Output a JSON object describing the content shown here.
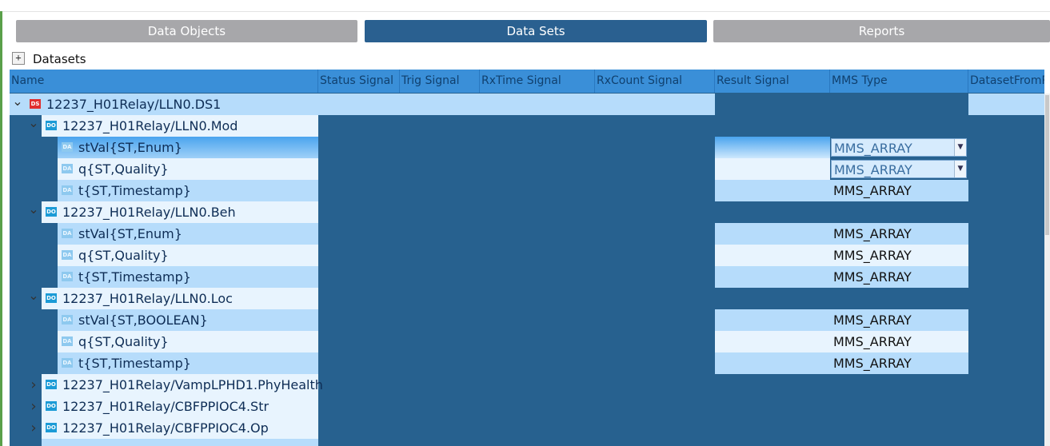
{
  "tabs": [
    {
      "label": "Data Objects",
      "active": false
    },
    {
      "label": "Data Sets",
      "active": true
    },
    {
      "label": "Reports",
      "active": false
    }
  ],
  "datasets_header": {
    "title": "Datasets",
    "expander": "+"
  },
  "columns": [
    "Name",
    "Status Signal",
    "Trig Signal",
    "RxTime Signal",
    "RxCount Signal",
    "Result Signal",
    "MMS Type",
    "DatasetFromR"
  ],
  "rows": [
    {
      "kind": "ds",
      "badge": "DS",
      "label": "12237_H01Relay/LLN0.DS1",
      "expanded": true,
      "mms": ""
    },
    {
      "kind": "do",
      "badge": "DO",
      "label": "12237_H01Relay/LLN0.Mod",
      "expanded": true,
      "mms": ""
    },
    {
      "kind": "da",
      "badge": "DA",
      "label": "stVal{ST,Enum}",
      "mms": "MMS_ARRAY",
      "mms_dropdown": true
    },
    {
      "kind": "da",
      "badge": "DA",
      "label": "q{ST,Quality}",
      "mms": "MMS_ARRAY",
      "mms_dropdown": true
    },
    {
      "kind": "da",
      "badge": "DA",
      "label": "t{ST,Timestamp}",
      "mms": "MMS_ARRAY"
    },
    {
      "kind": "do",
      "badge": "DO",
      "label": "12237_H01Relay/LLN0.Beh",
      "expanded": true,
      "mms": ""
    },
    {
      "kind": "da",
      "badge": "DA",
      "label": "stVal{ST,Enum}",
      "mms": "MMS_ARRAY"
    },
    {
      "kind": "da",
      "badge": "DA",
      "label": "q{ST,Quality}",
      "mms": "MMS_ARRAY"
    },
    {
      "kind": "da",
      "badge": "DA",
      "label": "t{ST,Timestamp}",
      "mms": "MMS_ARRAY"
    },
    {
      "kind": "do",
      "badge": "DO",
      "label": "12237_H01Relay/LLN0.Loc",
      "expanded": true,
      "mms": ""
    },
    {
      "kind": "da",
      "badge": "DA",
      "label": "stVal{ST,BOOLEAN}",
      "mms": "MMS_ARRAY"
    },
    {
      "kind": "da",
      "badge": "DA",
      "label": "q{ST,Quality}",
      "mms": "MMS_ARRAY"
    },
    {
      "kind": "da",
      "badge": "DA",
      "label": "t{ST,Timestamp}",
      "mms": "MMS_ARRAY"
    },
    {
      "kind": "do",
      "badge": "DO",
      "label": "12237_H01Relay/VampLPHD1.PhyHealth",
      "expanded": false,
      "mms": ""
    },
    {
      "kind": "do",
      "badge": "DO",
      "label": "12237_H01Relay/CBFPPIOC4.Str",
      "expanded": false,
      "mms": ""
    },
    {
      "kind": "do",
      "badge": "DO",
      "label": "12237_H01Relay/CBFPPIOC4.Op",
      "expanded": false,
      "mms": ""
    }
  ],
  "icons": {
    "expanded": "chevron-down-icon",
    "collapsed": "chevron-right-icon"
  },
  "colors": {
    "active_tab": "#2a6090",
    "inactive_tab": "#a7a7aa",
    "grid_bg": "#27618f",
    "header_bg": "#3a8fd8",
    "row_light": "#e8f4fe",
    "row_mid": "#b6dcfb",
    "row_selected": "#5aaef0"
  }
}
